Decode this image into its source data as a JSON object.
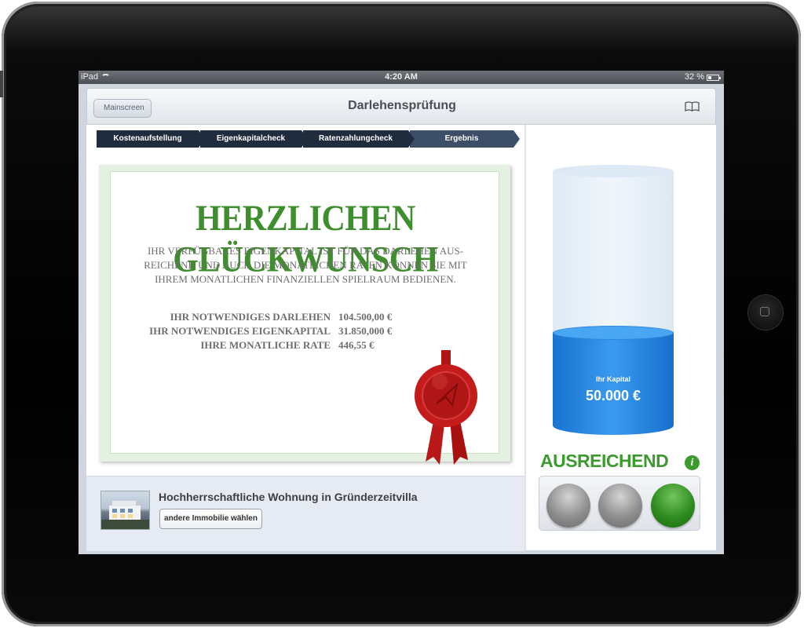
{
  "statusbar": {
    "carrier": "iPad",
    "time": "4:20 AM",
    "battery": "32 %",
    "battery_level": 0.32
  },
  "navbar": {
    "back_label": "Mainscreen",
    "title": "Darlehensprüfung",
    "right_icon": "book-icon"
  },
  "steps": [
    {
      "label": "Kostenaufstellung",
      "active": false
    },
    {
      "label": "Eigenkapitalcheck",
      "active": false
    },
    {
      "label": "Ratenzahlungcheck",
      "active": false
    },
    {
      "label": "Ergebnis",
      "active": true
    }
  ],
  "certificate": {
    "headline": "HERZLICHEN GLÜCKWUNSCH",
    "body_lines": [
      "IHR VERFÜGBARES EIGENKAPITAL IST FÜR DAS DARLEHEN AUS-",
      "REICHEND UND AUCH DIE MONATLICHEN RATEN KÖNNEN SIE MIT",
      "IHREM MONATLICHEN FINANZIELLEN SPIELRAUM BEDIENEN."
    ],
    "rows": [
      {
        "label": "IHR NOTWENDIGES DARLEHEN",
        "value": "104.500,00 €"
      },
      {
        "label": "IHR NOTWENDIGES EIGENKAPITAL",
        "value": "31.850,000 €"
      },
      {
        "label": "IHRE MONATLICHE RATE",
        "value": "446,55 €"
      }
    ],
    "seal_icon": "wax-seal-icon",
    "accent_color": "#3e8e2d"
  },
  "property": {
    "title": "Hochherrschaftliche Wohnung in Gründerzeitvilla",
    "button_label": "andere Immobilie wählen"
  },
  "capital": {
    "label": "Ihr Kapital",
    "value": "50.000 €",
    "fill_fraction": 0.39,
    "color": "#2a86e0"
  },
  "result": {
    "status": "AUSREICHEND",
    "status_color": "#3c9a2f",
    "info_icon": "info-icon",
    "lights": [
      "gray",
      "gray",
      "green"
    ]
  }
}
